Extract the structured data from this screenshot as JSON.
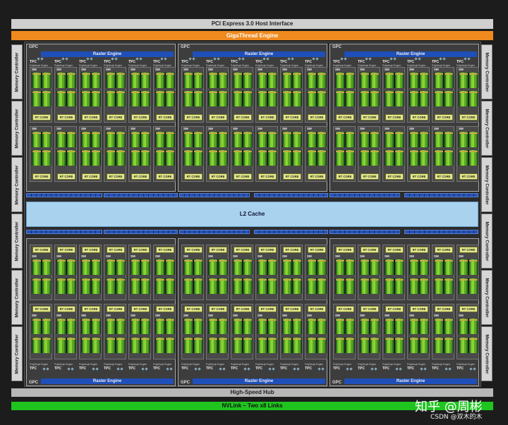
{
  "top": {
    "pcie": "PCI Express 3.0 Host Interface",
    "gigathread": "GigaThread Engine"
  },
  "bottom": {
    "hub": "High-Speed Hub",
    "nvlink": "NVLink – Two x8 Links"
  },
  "memory_controller": "Memory Controller",
  "l2": "L2 Cache",
  "gpc_label": "GPC",
  "raster": "Raster Engine",
  "tpc_label": "TPC",
  "polymorph": "PolyMorph Engine",
  "sm_label": "SM",
  "rt_core": "RT CORE",
  "watermark": "知乎 @周彬",
  "csdn": "CSDN @双木的木",
  "colors": {
    "gigathread": "#f08a1e",
    "nvlink": "#1fc41f",
    "l2": "#a9d2ee",
    "raster": "#1f4fb8",
    "rt_core": "#e4e98a",
    "cuda_core": "#73c22a"
  }
}
